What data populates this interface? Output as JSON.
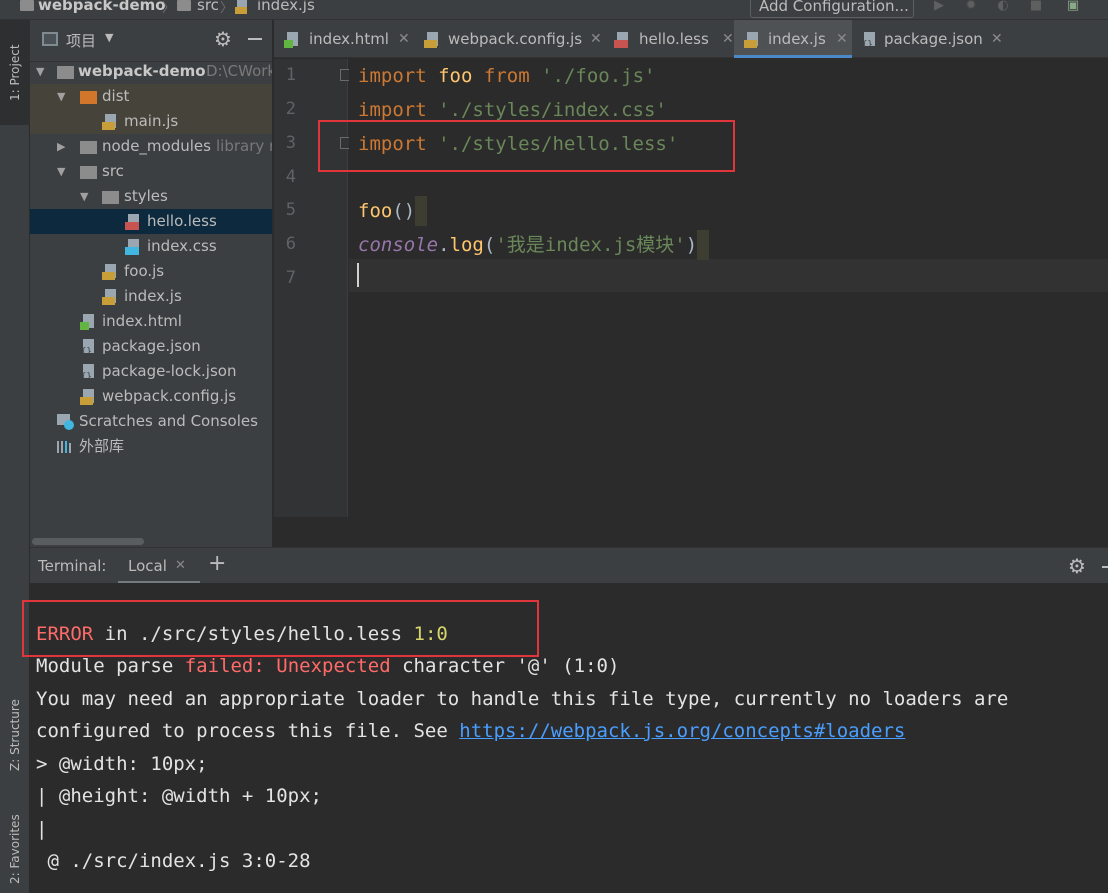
{
  "breadcrumb": {
    "project": "webpack-demo",
    "folder": "src",
    "file": "index.js"
  },
  "toolbar": {
    "add_config_label": "Add Configuration..."
  },
  "left_strip": {
    "project_tab": "1: Project",
    "structure_tab": "Z: Structure",
    "favorites_tab": "2: Favorites"
  },
  "project_panel": {
    "title": "项目",
    "tree": [
      {
        "label": "webpack-demo",
        "hint": "D:\\CWork",
        "icon": "folder-icon"
      },
      {
        "label": "dist",
        "icon": "folder-icon"
      },
      {
        "label": "main.js",
        "icon": "js-file-icon"
      },
      {
        "label": "node_modules",
        "hint": "library r",
        "icon": "folder-icon"
      },
      {
        "label": "src",
        "icon": "folder-icon"
      },
      {
        "label": "styles",
        "icon": "folder-icon"
      },
      {
        "label": "hello.less",
        "icon": "less-file-icon"
      },
      {
        "label": "index.css",
        "icon": "css-file-icon"
      },
      {
        "label": "foo.js",
        "icon": "js-file-icon"
      },
      {
        "label": "index.js",
        "icon": "js-file-icon"
      },
      {
        "label": "index.html",
        "icon": "html-file-icon"
      },
      {
        "label": "package.json",
        "icon": "json-file-icon"
      },
      {
        "label": "package-lock.json",
        "icon": "json-file-icon"
      },
      {
        "label": "webpack.config.js",
        "icon": "js-file-icon"
      },
      {
        "label": "Scratches and Consoles",
        "icon": "scratches-icon"
      },
      {
        "label": "外部库",
        "icon": "library-icon"
      }
    ]
  },
  "editor": {
    "tabs": [
      {
        "label": "index.html",
        "icon": "html-file-icon"
      },
      {
        "label": "webpack.config.js",
        "icon": "js-file-icon"
      },
      {
        "label": "hello.less",
        "icon": "less-file-icon"
      },
      {
        "label": "index.js",
        "icon": "js-file-icon",
        "active": true
      },
      {
        "label": "package.json",
        "icon": "json-file-icon"
      }
    ],
    "line_numbers": [
      "1",
      "2",
      "3",
      "4",
      "5",
      "6",
      "7"
    ],
    "code": {
      "l1_kw1": "import",
      "l1_id": "foo",
      "l1_kw2": "from",
      "l1_str": "'./foo.js'",
      "l2_kw": "import",
      "l2_str": "'./styles/index.css'",
      "l3_kw": "import",
      "l3_str": "'./styles/hello.less'",
      "l5_call": "foo",
      "l5_parens": "()",
      "l6_obj": "console",
      "l6_dot": ".",
      "l6_fn": "log",
      "l6_open": "(",
      "l6_str": "'我是index.js模块'",
      "l6_close": ")"
    }
  },
  "terminal": {
    "label": "Terminal:",
    "tab": "Local",
    "lines": {
      "err_word": "ERROR",
      "err_in": " in ./src/styles/hello.less ",
      "err_pos": "1:0",
      "mp_a": "Module parse ",
      "mp_failed": "failed:",
      "mp_sp": " ",
      "mp_unexpected": "Unexpected",
      "mp_rest": " character '@' (1:0)",
      "l3": "You may need an appropriate loader to handle this file type, currently no loaders are",
      "l4_a": "configured to process this file. See ",
      "l4_link": "https://webpack.js.org/concepts#loaders",
      "l5": "> @width: 10px;",
      "l6": "| @height: @width + 10px;",
      "l7": "|",
      "l8": " @ ./src/index.js 3:0-28"
    }
  },
  "colors": {
    "error_box": "#e0353b",
    "keyword": "#cc7832",
    "string": "#6a8759",
    "function": "#ffc66d",
    "selection": "#0d293e",
    "active_tab_underline": "#4a88c7"
  }
}
